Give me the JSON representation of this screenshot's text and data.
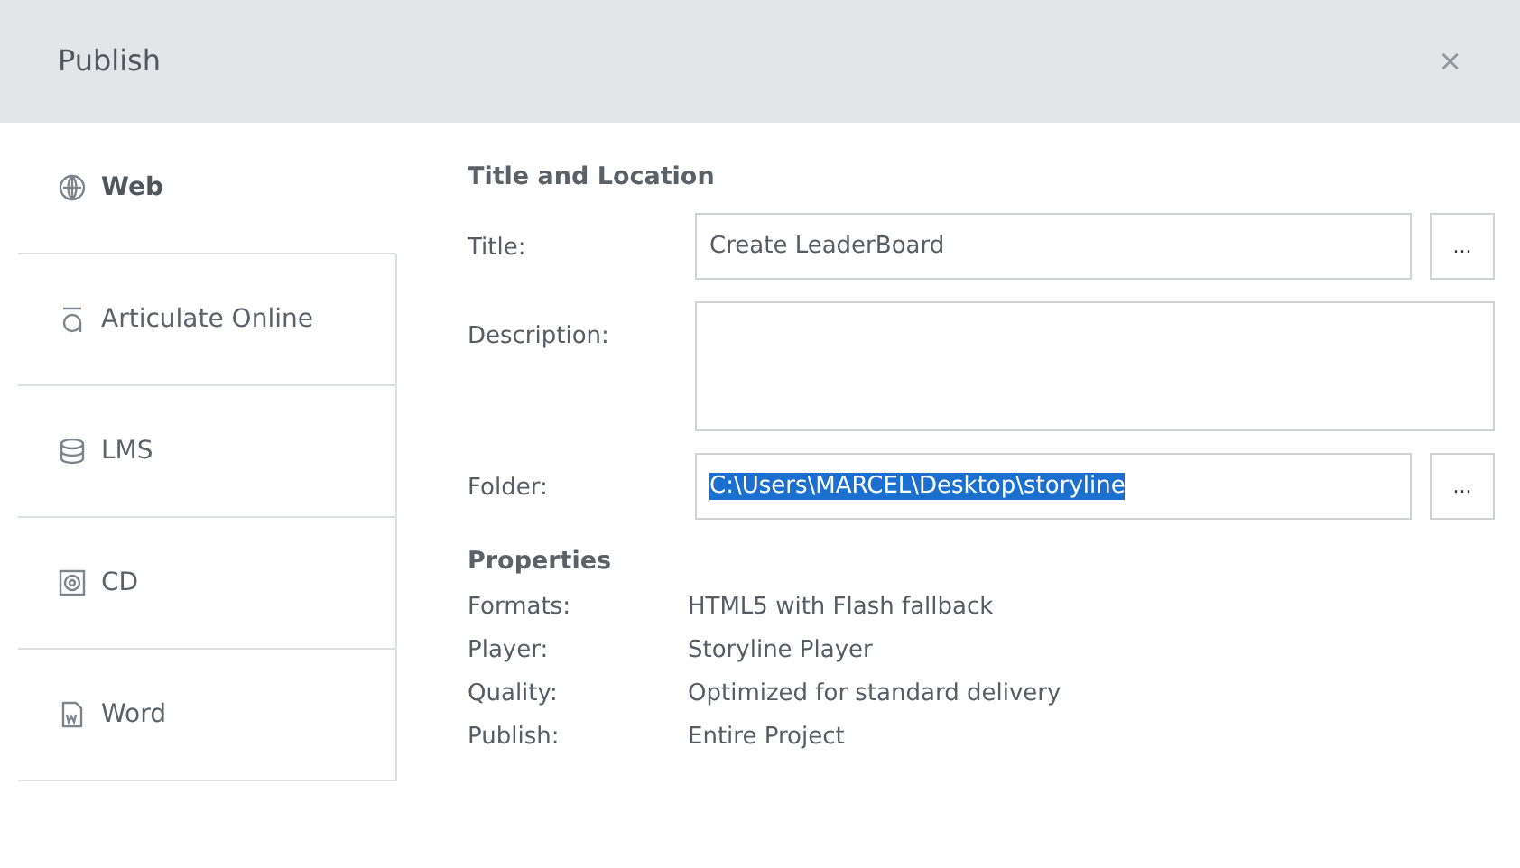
{
  "window": {
    "title": "Publish",
    "close": "×"
  },
  "sidebar": {
    "items": [
      {
        "label": "Web",
        "kind": "web",
        "selected": true
      },
      {
        "label": "Articulate Online",
        "kind": "online",
        "selected": false
      },
      {
        "label": "LMS",
        "kind": "lms",
        "selected": false
      },
      {
        "label": "CD",
        "kind": "cd",
        "selected": false
      },
      {
        "label": "Word",
        "kind": "word",
        "selected": false
      }
    ]
  },
  "title_location": {
    "heading": "Title and Location",
    "fields": [
      {
        "label": "Title:",
        "kind": "line",
        "value": "Create LeaderBoard",
        "button": "...",
        "value_selected": false
      },
      {
        "label": "Description:",
        "kind": "area"
      },
      {
        "label": "Folder:",
        "kind": "line",
        "value": "C:\\Users\\MARCEL\\Desktop\\storyline",
        "button": "...",
        "value_selected": true
      }
    ]
  },
  "properties": {
    "heading": "Properties",
    "rows": [
      {
        "label": "Formats:",
        "value": "HTML5 with Flash fallback"
      },
      {
        "label": "Player:",
        "value": "Storyline Player"
      },
      {
        "label": "Quality:",
        "value": "Optimized for standard delivery"
      },
      {
        "label": "Publish:",
        "value": "Entire Project"
      }
    ]
  }
}
